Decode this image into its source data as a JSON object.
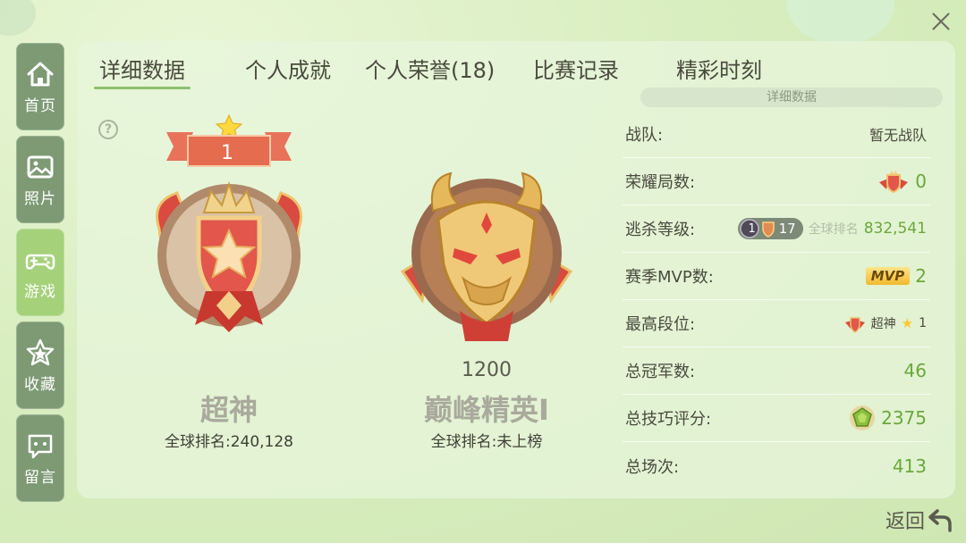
{
  "close": {
    "label": "close"
  },
  "sidebar": {
    "items": [
      {
        "label": "首页",
        "icon": "home-icon"
      },
      {
        "label": "照片",
        "icon": "photo-icon"
      },
      {
        "label": "游戏",
        "icon": "gamepad-icon"
      },
      {
        "label": "收藏",
        "icon": "star-icon"
      },
      {
        "label": "留言",
        "icon": "message-icon"
      }
    ],
    "active_index": 2
  },
  "tabs": [
    {
      "label": "详细数据"
    },
    {
      "label": "个人成就"
    },
    {
      "label": "个人荣誉(18)"
    },
    {
      "label": "比赛记录"
    },
    {
      "label": "精彩时刻"
    }
  ],
  "active_tab": 0,
  "sub_tab": "详细数据",
  "help": "?",
  "rank_left": {
    "badge_number": "1",
    "name": "超神",
    "global_rank_label": "全球排名:",
    "global_rank_value": "240,128"
  },
  "rank_right": {
    "points": "1200",
    "name": "巅峰精英Ⅰ",
    "global_rank_label": "全球排名:",
    "global_rank_value": "未上榜"
  },
  "stats": {
    "team_label": "战队:",
    "team_value": "暂无战队",
    "glory_label": "荣耀局数:",
    "glory_value": "0",
    "escape_label": "逃杀等级:",
    "escape_badge_1": "1",
    "escape_badge_2": "17",
    "escape_rank_label": "全球排名",
    "escape_rank_value": "832,541",
    "mvp_label": "赛季MVP数:",
    "mvp_tag": "MVP",
    "mvp_value": "2",
    "highest_label": "最高段位:",
    "highest_value": "超神",
    "highest_stars": "1",
    "champion_label": "总冠军数:",
    "champion_value": "46",
    "skill_label": "总技巧评分:",
    "skill_value": "2375",
    "total_label": "总场次:",
    "total_value": "413"
  },
  "back": {
    "label": "返回"
  },
  "colors": {
    "accent_green": "#6aa83b",
    "sidebar": "#7d9a74",
    "sidebar_active": "#a5d17a"
  }
}
